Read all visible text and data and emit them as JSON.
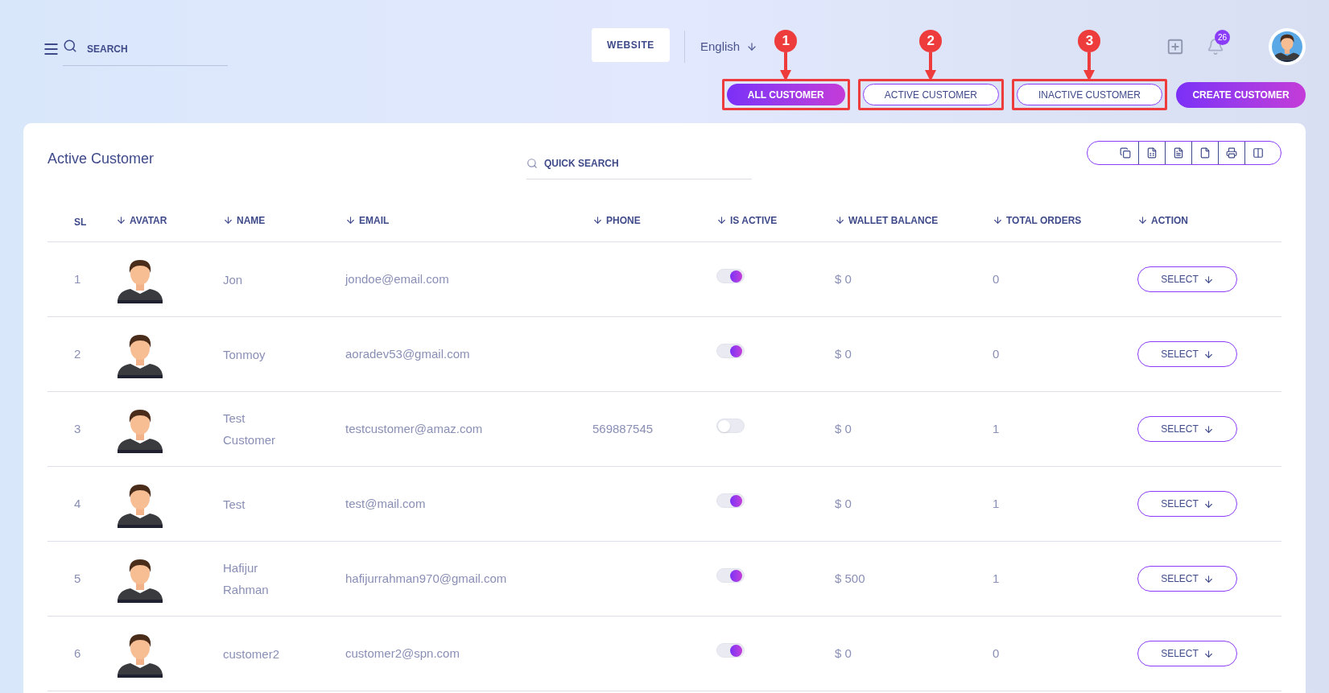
{
  "topbar": {
    "search": {
      "placeholder": "SEARCH"
    },
    "website_button": "WEBSITE",
    "language": "English",
    "notification_count": "26"
  },
  "filters": [
    {
      "label": "ALL CUSTOMER",
      "selected": true,
      "callout": "1"
    },
    {
      "label": "ACTIVE CUSTOMER",
      "selected": false,
      "callout": "2"
    },
    {
      "label": "INACTIVE CUSTOMER",
      "selected": false,
      "callout": "3"
    }
  ],
  "create_button": "CREATE CUSTOMER",
  "card": {
    "title": "Active Customer",
    "quick_search": {
      "placeholder": "QUICK SEARCH"
    },
    "export_tools": [
      {
        "kind": "copy"
      },
      {
        "kind": "excel"
      },
      {
        "kind": "csv"
      },
      {
        "kind": "pdf"
      },
      {
        "kind": "print"
      },
      {
        "kind": "columns"
      }
    ]
  },
  "table": {
    "columns": [
      {
        "label": "SL",
        "sortable": false
      },
      {
        "label": "AVATAR",
        "sortable": true
      },
      {
        "label": "NAME",
        "sortable": true
      },
      {
        "label": "EMAIL",
        "sortable": true
      },
      {
        "label": "PHONE",
        "sortable": true
      },
      {
        "label": "IS ACTIVE",
        "sortable": true
      },
      {
        "label": "WALLET BALANCE",
        "sortable": true
      },
      {
        "label": "TOTAL ORDERS",
        "sortable": true
      },
      {
        "label": "ACTION",
        "sortable": true
      }
    ],
    "rows": [
      {
        "sl": "1",
        "name": "Jon",
        "email": "jondoe@email.com",
        "phone": "",
        "is_active": true,
        "wallet_balance": "$ 0",
        "total_orders": "0",
        "action": "SELECT"
      },
      {
        "sl": "2",
        "name": "Tonmoy",
        "email": "aoradev53@gmail.com",
        "phone": "",
        "is_active": true,
        "wallet_balance": "$ 0",
        "total_orders": "0",
        "action": "SELECT"
      },
      {
        "sl": "3",
        "name": "Test Customer",
        "email": "testcustomer@amaz.com",
        "phone": "569887545",
        "is_active": false,
        "wallet_balance": "$ 0",
        "total_orders": "1",
        "action": "SELECT"
      },
      {
        "sl": "4",
        "name": "Test",
        "email": "test@mail.com",
        "phone": "",
        "is_active": true,
        "wallet_balance": "$ 0",
        "total_orders": "1",
        "action": "SELECT"
      },
      {
        "sl": "5",
        "name": "Hafijur Rahman",
        "email": "hafijurrahman970@gmail.com",
        "phone": "",
        "is_active": true,
        "wallet_balance": "$ 500",
        "total_orders": "1",
        "action": "SELECT"
      },
      {
        "sl": "6",
        "name": "customer2",
        "email": "customer2@spn.com",
        "phone": "",
        "is_active": true,
        "wallet_balance": "$ 0",
        "total_orders": "0",
        "action": "SELECT"
      }
    ]
  }
}
